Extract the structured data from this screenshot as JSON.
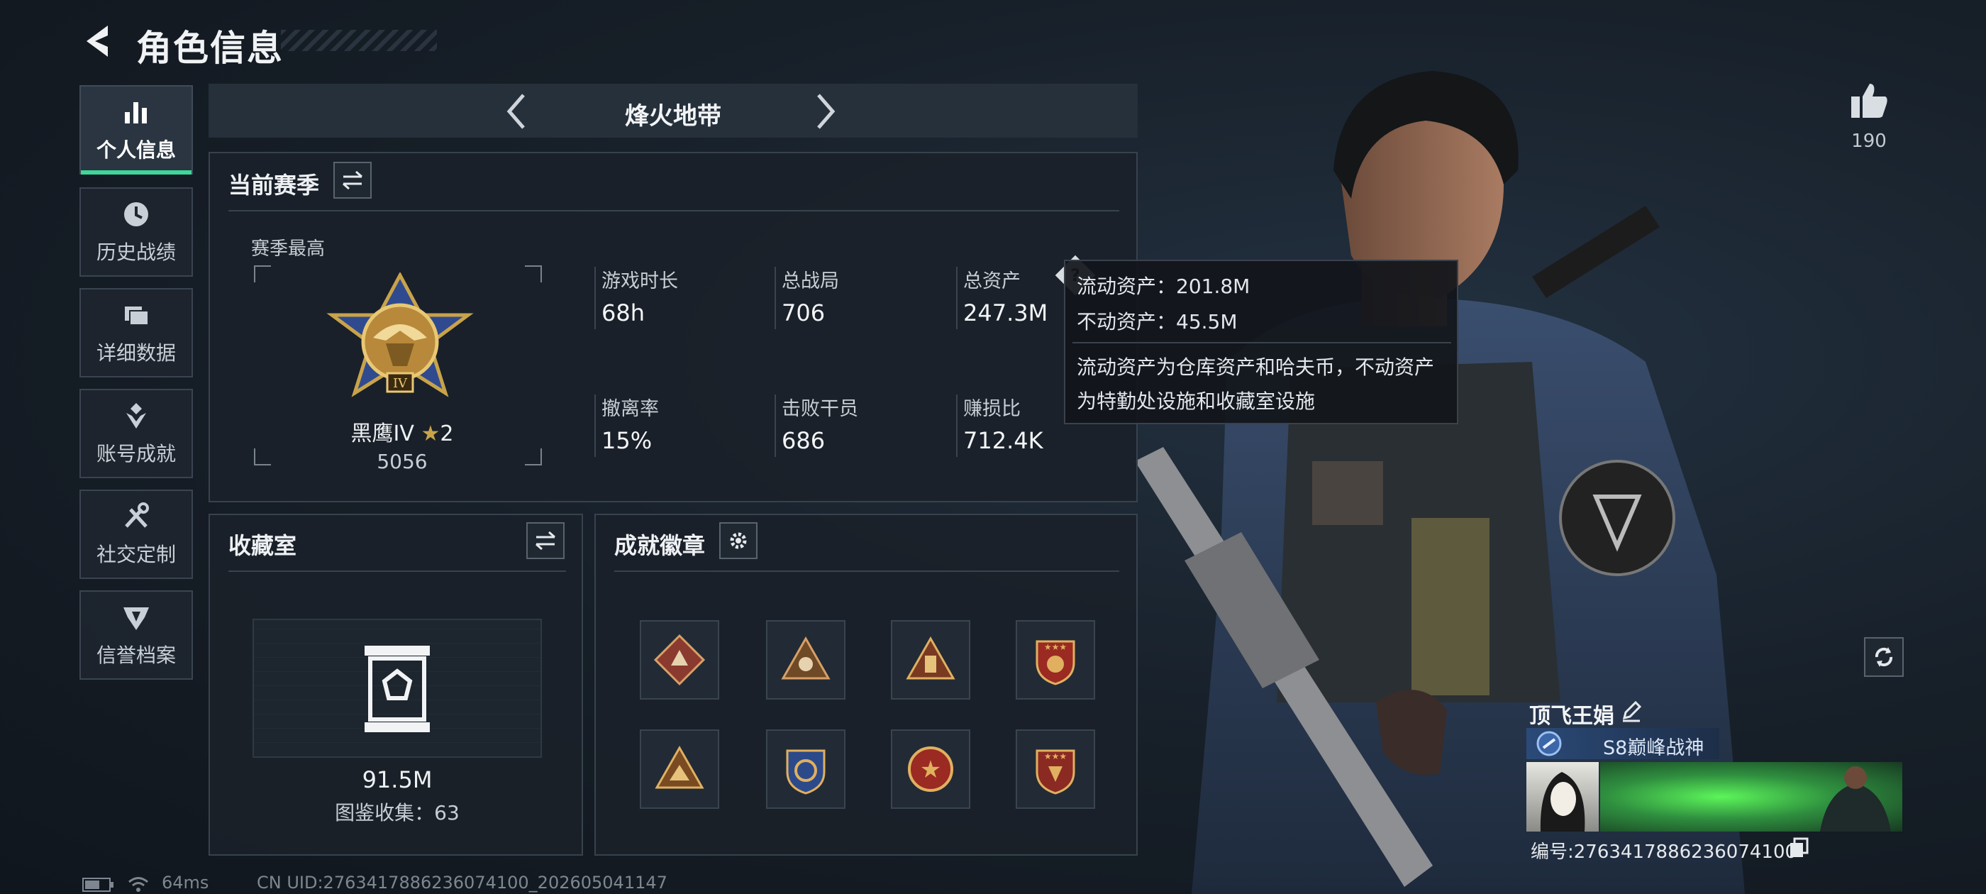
{
  "header": {
    "title": "角色信息"
  },
  "nav": [
    {
      "label": "个人信息",
      "icon": "bar-chart-icon",
      "active": true
    },
    {
      "label": "历史战绩",
      "icon": "clock-icon",
      "active": false
    },
    {
      "label": "详细数据",
      "icon": "folders-icon",
      "active": false
    },
    {
      "label": "账号成就",
      "icon": "achievement-icon",
      "active": false
    },
    {
      "label": "社交定制",
      "icon": "tools-icon",
      "active": false
    },
    {
      "label": "信誉档案",
      "icon": "shield-badge-icon",
      "active": false
    }
  ],
  "mode": {
    "title": "烽火地带"
  },
  "season": {
    "title": "当前赛季",
    "best_label": "赛季最高",
    "rank_name": "黑鹰IV",
    "rank_stars": "2",
    "rank_score": "5056",
    "stats": [
      {
        "label": "游戏时长",
        "value": "68h"
      },
      {
        "label": "总战局",
        "value": "706"
      },
      {
        "label": "总资产",
        "value": "247.3M"
      },
      {
        "label": "撤离率",
        "value": "15%"
      },
      {
        "label": "击败干员",
        "value": "686"
      },
      {
        "label": "赚损比",
        "value": "712.4K"
      }
    ]
  },
  "tooltip": {
    "liquid": "流动资产：201.8M",
    "fixed": "不动资产：45.5M",
    "desc1": "流动资产为仓库资产和哈夫币，不动资产",
    "desc2": "为特勤处设施和收藏室设施"
  },
  "collection": {
    "title": "收藏室",
    "value": "91.5M",
    "caption": "图鉴收集：63"
  },
  "achievements": {
    "title": "成就徽章"
  },
  "likes": {
    "count": "190"
  },
  "player": {
    "name": "顶飞王娟",
    "title": "S8巅峰战神",
    "id_label": "编号:2763417886236074100"
  },
  "status": {
    "ping": "64ms",
    "uid": "CN UID:2763417886236074100_202605041147"
  },
  "colors": {
    "accent": "#3fd69a",
    "gold": "#c9a34a",
    "card_green": "#2f8f3f"
  }
}
